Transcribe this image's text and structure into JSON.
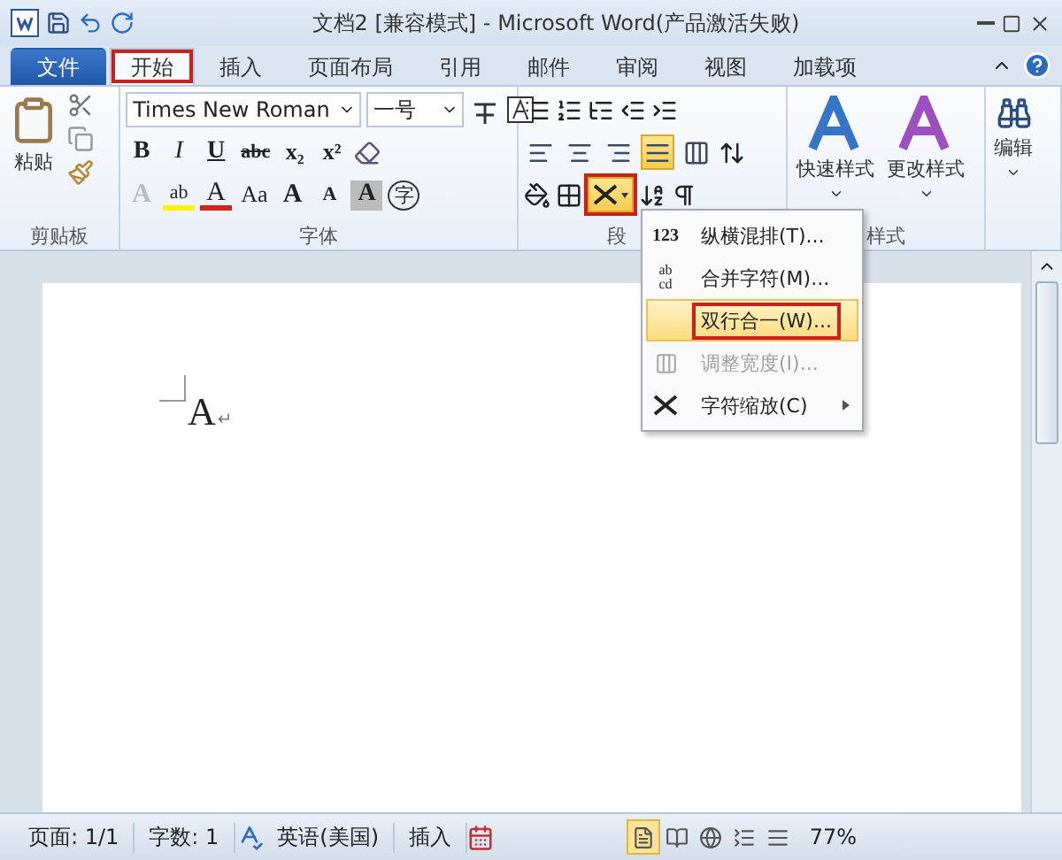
{
  "window": {
    "title": "文档2 [兼容模式]  -  Microsoft Word(产品激活失败)"
  },
  "tabs": [
    {
      "label": "文件",
      "kind": "file",
      "selected": false,
      "outlined": false
    },
    {
      "label": "开始",
      "kind": "tab",
      "selected": true,
      "outlined": true
    },
    {
      "label": "插入",
      "kind": "tab",
      "selected": false,
      "outlined": false
    },
    {
      "label": "页面布局",
      "kind": "tab",
      "selected": false,
      "outlined": false
    },
    {
      "label": "引用",
      "kind": "tab",
      "selected": false,
      "outlined": false
    },
    {
      "label": "邮件",
      "kind": "tab",
      "selected": false,
      "outlined": false
    },
    {
      "label": "审阅",
      "kind": "tab",
      "selected": false,
      "outlined": false
    },
    {
      "label": "视图",
      "kind": "tab",
      "selected": false,
      "outlined": false
    },
    {
      "label": "加载项",
      "kind": "tab",
      "selected": false,
      "outlined": false
    }
  ],
  "ribbon": {
    "clipboard": {
      "paste": "粘贴",
      "label": "剪贴板"
    },
    "font": {
      "name": "Times New Roman",
      "size": "一号",
      "label": "字体",
      "buttons": [
        {
          "glyph": "B",
          "kind": "bold"
        },
        {
          "glyph": "I",
          "kind": "italic"
        },
        {
          "glyph": "U",
          "kind": "underline"
        },
        {
          "glyph": "abc",
          "kind": "strike"
        },
        {
          "glyph": "x₂",
          "kind": "sub"
        },
        {
          "glyph": "x²",
          "kind": "sup"
        }
      ],
      "buttons2": [
        {
          "glyph": "A",
          "kind": "effects"
        },
        {
          "glyph": "ab",
          "kind": "highlight"
        },
        {
          "glyph": "A",
          "kind": "color"
        },
        {
          "glyph": "Aa",
          "kind": "case"
        },
        {
          "glyph": "A",
          "kind": "grow"
        },
        {
          "glyph": "A",
          "kind": "shrink"
        },
        {
          "glyph": "A",
          "kind": "shade"
        },
        {
          "glyph": "字",
          "kind": "enclose"
        }
      ]
    },
    "paragraph": {
      "label": "段",
      "align": [
        {
          "kind": "left",
          "selected": false
        },
        {
          "kind": "center",
          "selected": false
        },
        {
          "kind": "right",
          "selected": false
        },
        {
          "kind": "justify",
          "selected": true
        },
        {
          "kind": "distributed",
          "selected": false
        }
      ],
      "layout_button": {
        "outlined": true,
        "open": true
      }
    },
    "styles": {
      "label": "样式",
      "items": [
        "快速样式",
        "更改样式"
      ]
    },
    "editing": {
      "label": "编辑"
    }
  },
  "document": {
    "text": "A",
    "mark": "↵"
  },
  "menu": [
    {
      "label": "纵横混排(T)...",
      "kind": "vertical",
      "icon_lines": [
        "123"
      ],
      "selected": false,
      "disabled": false,
      "outlined": false,
      "submenu": false
    },
    {
      "label": "合并字符(M)...",
      "kind": "combine",
      "icon_lines": [
        "ab",
        "cd"
      ],
      "selected": false,
      "disabled": false,
      "outlined": false,
      "submenu": false
    },
    {
      "label": "双行合一(W)...",
      "kind": "none",
      "selected": true,
      "disabled": false,
      "outlined": true,
      "submenu": false
    },
    {
      "label": "调整宽度(I)...",
      "kind": "width",
      "selected": false,
      "disabled": true,
      "outlined": false,
      "submenu": false
    },
    {
      "label": "字符缩放(C)",
      "kind": "scale",
      "selected": false,
      "disabled": false,
      "outlined": false,
      "submenu": true
    }
  ],
  "status_bar": {
    "page": "页面: 1/1",
    "words": "字数: 1",
    "language": "英语(美国)",
    "mode": "插入",
    "zoom": "77%",
    "views": [
      {
        "kind": "print",
        "selected": true
      },
      {
        "kind": "read",
        "selected": false
      },
      {
        "kind": "web",
        "selected": false
      },
      {
        "kind": "outline",
        "selected": false
      },
      {
        "kind": "draft",
        "selected": false
      }
    ]
  }
}
